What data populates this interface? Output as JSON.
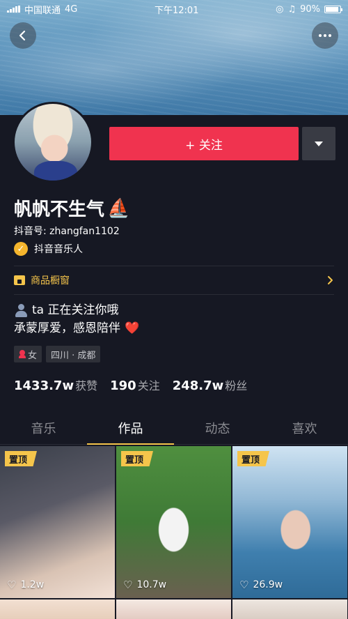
{
  "status_bar": {
    "carrier": "中国联通",
    "network": "4G",
    "time": "下午12:01",
    "battery": "90%",
    "battery_level": 0.9
  },
  "profile": {
    "name": "帆帆不生气",
    "name_emoji": "⛵",
    "douyin_id_label": "抖音号: zhangfan1102",
    "verification": "抖音音乐人",
    "follow_button": "+ 关注",
    "shop_label": "商品橱窗",
    "bio_line1": "ta 正在关注你哦",
    "bio_line2": "承蒙厚爱，感恩陪伴",
    "bio_emoji": "❤️",
    "tags": [
      "女",
      "四川 · 成都"
    ],
    "stats": [
      {
        "value": "1433.7w",
        "label": "获赞"
      },
      {
        "value": "190",
        "label": "关注"
      },
      {
        "value": "248.7w",
        "label": "粉丝"
      }
    ]
  },
  "tabs": [
    "音乐",
    "作品",
    "动态",
    "喜欢"
  ],
  "active_tab": "作品",
  "videos": [
    {
      "pinned": "置顶",
      "likes": "1.2w"
    },
    {
      "pinned": "置顶",
      "likes": "10.7w"
    },
    {
      "pinned": "置顶",
      "likes": "26.9w"
    }
  ],
  "colors": {
    "background": "#161823",
    "follow": "#f0334f",
    "accent": "#f5c54b"
  }
}
